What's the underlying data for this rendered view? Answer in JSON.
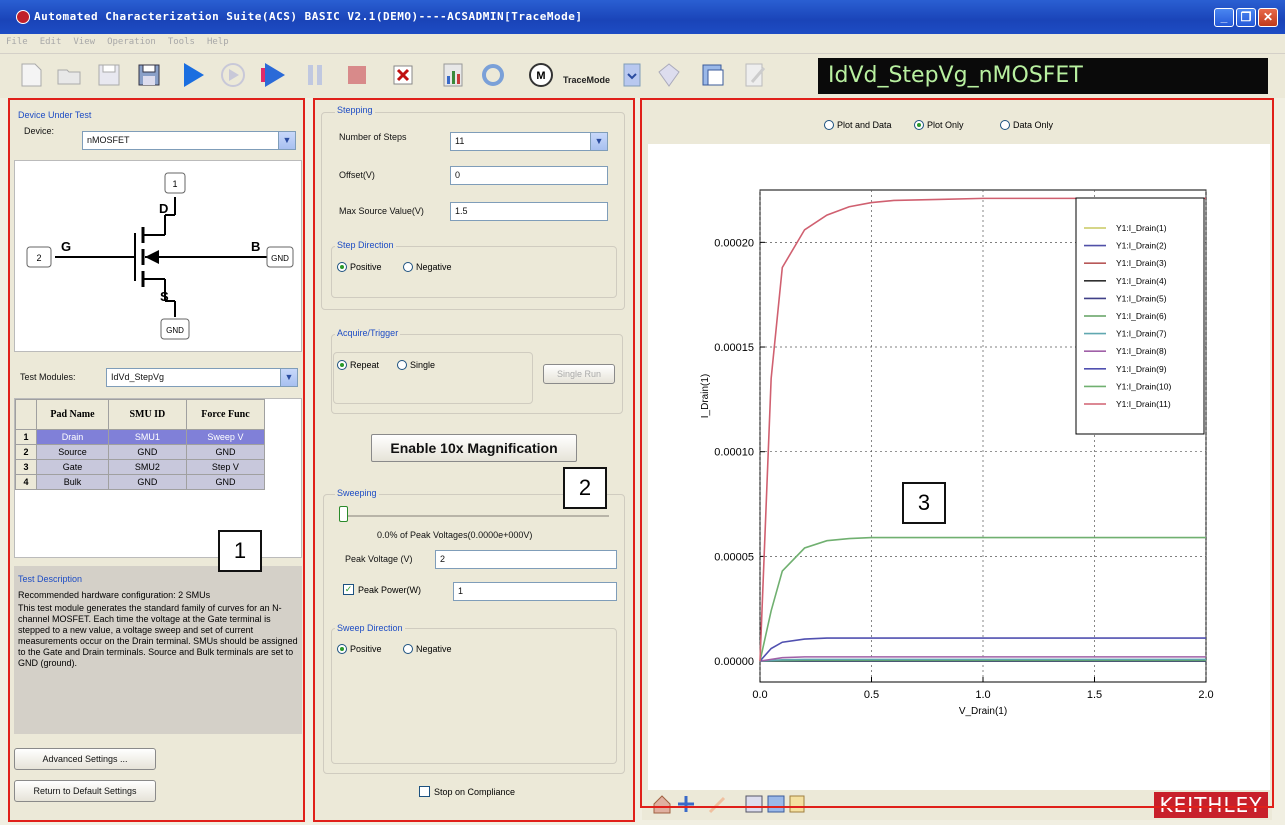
{
  "window": {
    "title": "Automated Characterization Suite(ACS) BASIC V2.1(DEMO)----ACSADMIN[TraceMode]"
  },
  "menu": [
    "File",
    "Edit",
    "View",
    "Operation",
    "Tools",
    "Help"
  ],
  "toolbar": {
    "trace_mode_label": "TraceMode",
    "test_name": "IdVd_StepVg_nMOSFET"
  },
  "dut": {
    "group_label": "Device Under Test",
    "device_label": "Device:",
    "device_value": "nMOSFET",
    "terminals": {
      "drain_letter": "D",
      "gate_letter": "G",
      "bulk_letter": "B",
      "source_letter": "S",
      "drain_box": "1",
      "gate_box": "2",
      "bulk_box": "GND",
      "source_box": "GND"
    },
    "test_modules_label": "Test Modules:",
    "test_modules_value": "IdVd_StepVg"
  },
  "pad_table": {
    "headers": [
      "Pad Name",
      "SMU ID",
      "Force Func"
    ],
    "rows": [
      {
        "num": "1",
        "pad": "Drain",
        "smu": "SMU1",
        "func": "Sweep V"
      },
      {
        "num": "2",
        "pad": "Source",
        "smu": "GND",
        "func": "GND"
      },
      {
        "num": "3",
        "pad": "Gate",
        "smu": "SMU2",
        "func": "Step V"
      },
      {
        "num": "4",
        "pad": "Bulk",
        "smu": "GND",
        "func": "GND"
      }
    ]
  },
  "description": {
    "heading": "Test Description",
    "line1": "Recommended hardware configuration: 2 SMUs",
    "body": "This test module generates the standard family of curves for an N-channel MOSFET. Each time the voltage at the Gate terminal is stepped to a new value, a voltage sweep and set of current measurements occur on the Drain terminal. SMUs should be assigned to the Gate and Drain terminals. Source and Bulk terminals are set to GND (ground)."
  },
  "buttons": {
    "advanced": "Advanced Settings ...",
    "return_default": "Return to Default Settings",
    "single_run": "Single Run",
    "magnify": "Enable 10x Magnification"
  },
  "stepping": {
    "group_label": "Stepping",
    "steps_label": "Number  of  Steps",
    "steps_value": "11",
    "offset_label": "Offset(V)",
    "offset_value": "0",
    "max_label": "Max Source Value(V)",
    "max_value": "1.5",
    "direction_label": "Step Direction",
    "positive": "Positive",
    "negative": "Negative"
  },
  "acquire": {
    "group_label": "Acquire/Trigger",
    "repeat": "Repeat",
    "single": "Single"
  },
  "sweeping": {
    "group_label": "Sweeping",
    "slider_fraction": 0.0,
    "percent_text": "0.0% of Peak Voltages(0.0000e+000V)",
    "peak_voltage_label": "Peak  Voltage (V)",
    "peak_voltage_value": "2",
    "peak_power_label": "Peak Power(W)",
    "peak_power_value": "1",
    "direction_label": "Sweep Direction",
    "positive": "Positive",
    "negative": "Negative",
    "stop_compliance": "Stop on Compliance"
  },
  "view_mode": {
    "plot_and_data": "Plot and Data",
    "plot_only": "Plot Only",
    "data_only": "Data Only"
  },
  "annotations": {
    "box1": "1",
    "box2": "2",
    "box3": "3"
  },
  "brand": "KEITHLEY",
  "colors": {
    "accent_red": "#e0201a",
    "title_blue": "#1d4cc4",
    "row_highlight": "#8080d8"
  },
  "chart_data": {
    "type": "line",
    "xlabel": "V_Drain(1)",
    "ylabel": "I_Drain(1)",
    "xlim": [
      0.0,
      2.0
    ],
    "ylim": [
      -1e-05,
      0.000225
    ],
    "x_ticks": [
      "0.0",
      "0.5",
      "1.0",
      "1.5",
      "2.0"
    ],
    "y_ticks": [
      "0.00000",
      "0.00005",
      "0.00010",
      "0.00015",
      "0.00020"
    ],
    "x": [
      0.0,
      0.05,
      0.1,
      0.2,
      0.3,
      0.4,
      0.5,
      0.6,
      0.8,
      1.0,
      1.2,
      1.5,
      2.0
    ],
    "grid": true,
    "legend_position": "top-right",
    "series": [
      {
        "name": "Y1:I_Drain(1)",
        "color": "#c8c860",
        "values": [
          0,
          0,
          0,
          0,
          0,
          0,
          0,
          0,
          0,
          0,
          0,
          0,
          0
        ]
      },
      {
        "name": "Y1:I_Drain(2)",
        "color": "#5050a8",
        "values": [
          0,
          0,
          0,
          0,
          0,
          0,
          0,
          0,
          0,
          0,
          0,
          0,
          0
        ]
      },
      {
        "name": "Y1:I_Drain(3)",
        "color": "#b85858",
        "values": [
          0,
          0,
          0,
          0,
          0,
          0,
          0,
          0,
          0,
          0,
          0,
          0,
          0
        ]
      },
      {
        "name": "Y1:I_Drain(4)",
        "color": "#303030",
        "values": [
          0,
          0,
          0,
          0,
          0,
          0,
          0,
          0,
          0,
          0,
          0,
          0,
          0
        ]
      },
      {
        "name": "Y1:I_Drain(5)",
        "color": "#404088",
        "values": [
          0,
          0,
          0,
          0,
          0,
          0,
          0,
          0,
          0,
          0,
          0,
          0,
          0
        ]
      },
      {
        "name": "Y1:I_Drain(6)",
        "color": "#60a060",
        "values": [
          0,
          1e-07,
          2e-07,
          3e-07,
          3e-07,
          3e-07,
          3e-07,
          3e-07,
          3e-07,
          3e-07,
          3e-07,
          3e-07,
          3e-07
        ]
      },
      {
        "name": "Y1:I_Drain(7)",
        "color": "#60a8b0",
        "values": [
          0,
          3e-07,
          6e-07,
          8e-07,
          8e-07,
          8e-07,
          8e-07,
          8e-07,
          8e-07,
          8e-07,
          8e-07,
          8e-07,
          8e-07
        ]
      },
      {
        "name": "Y1:I_Drain(8)",
        "color": "#a060a8",
        "values": [
          0,
          8e-07,
          1.6e-06,
          2e-06,
          2e-06,
          2e-06,
          2e-06,
          2e-06,
          2e-06,
          2e-06,
          2e-06,
          2e-06,
          2e-06
        ]
      },
      {
        "name": "Y1:I_Drain(9)",
        "color": "#5050b0",
        "values": [
          0,
          6e-06,
          9e-06,
          1.05e-05,
          1.1e-05,
          1.1e-05,
          1.1e-05,
          1.1e-05,
          1.1e-05,
          1.1e-05,
          1.1e-05,
          1.1e-05,
          1.1e-05
        ]
      },
      {
        "name": "Y1:I_Drain(10)",
        "color": "#70b070",
        "values": [
          0,
          2.4e-05,
          4.3e-05,
          5.4e-05,
          5.75e-05,
          5.85e-05,
          5.9e-05,
          5.9e-05,
          5.9e-05,
          5.9e-05,
          5.9e-05,
          5.9e-05,
          5.9e-05
        ]
      },
      {
        "name": "Y1:I_Drain(11)",
        "color": "#d06070",
        "values": [
          0,
          0.000135,
          0.000188,
          0.000206,
          0.000213,
          0.000217,
          0.000219,
          0.00022,
          0.0002205,
          0.000221,
          0.000221,
          0.000221,
          0.000221
        ]
      }
    ]
  }
}
